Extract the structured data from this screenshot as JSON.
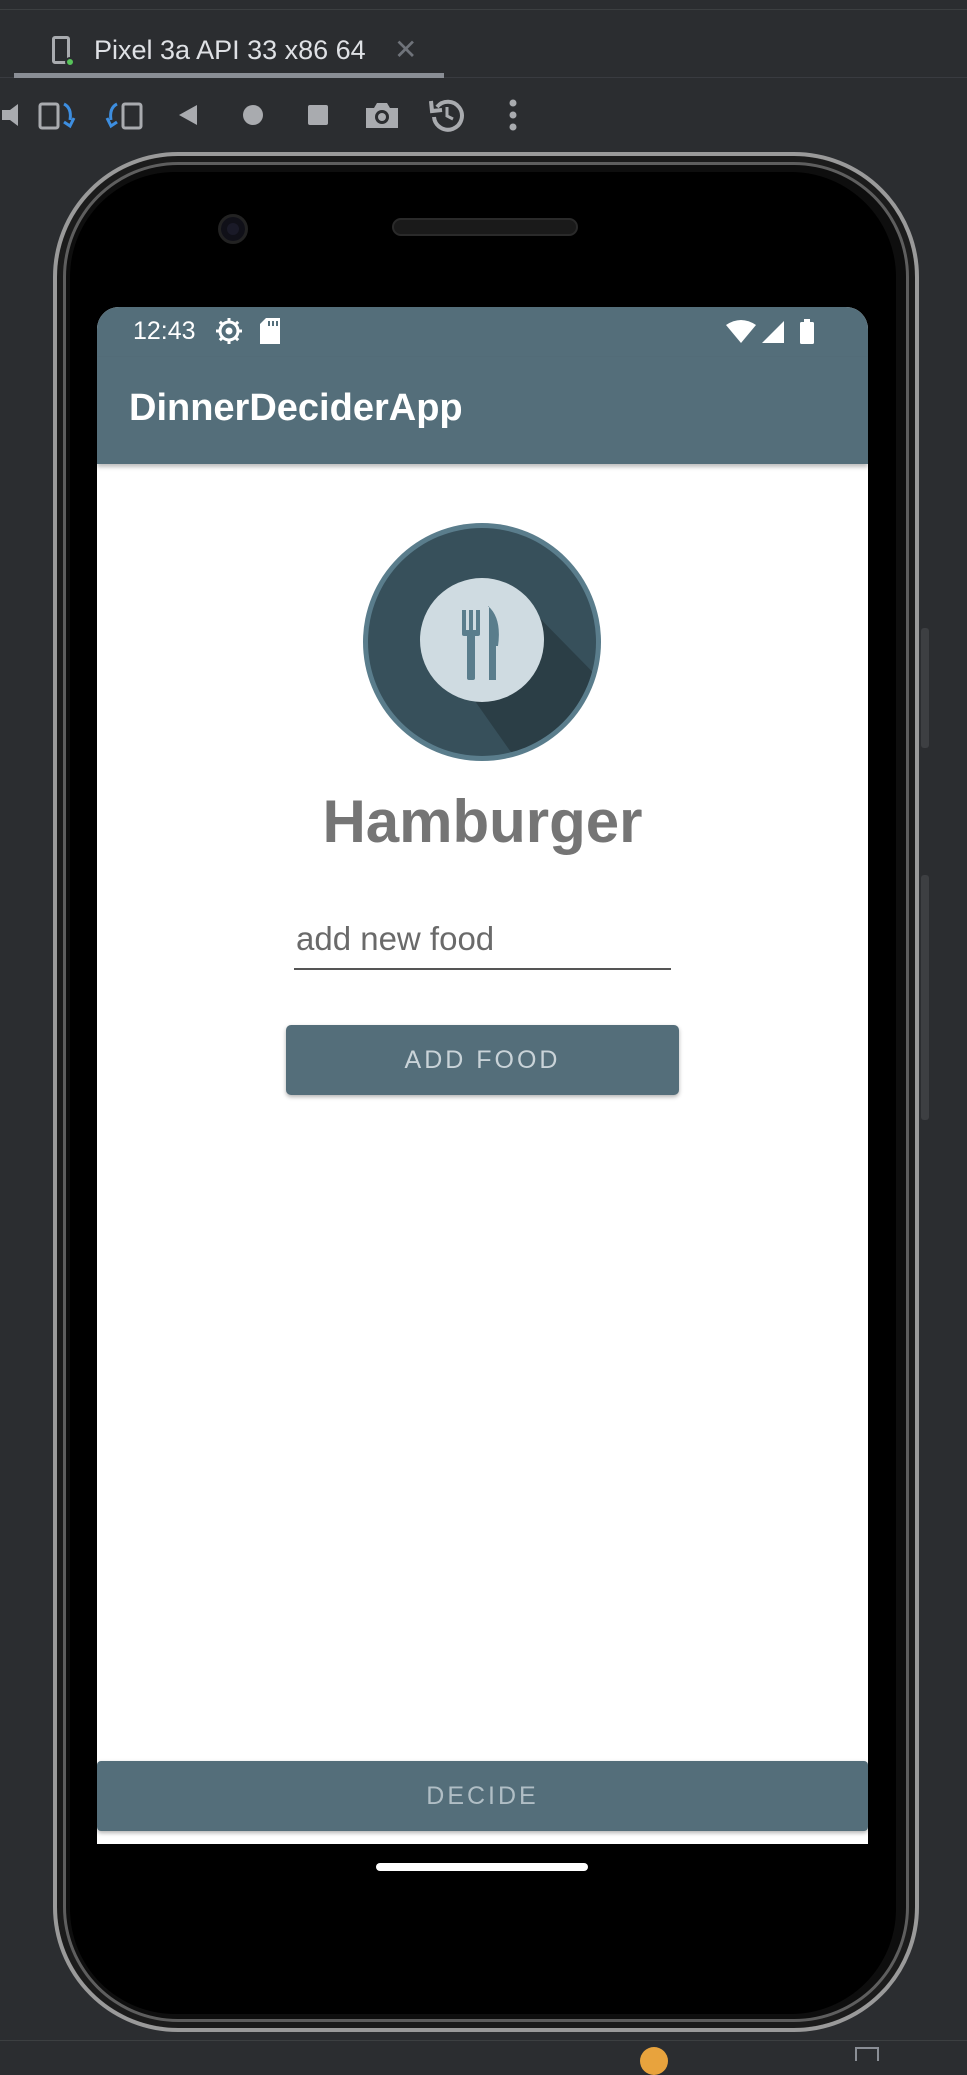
{
  "ide": {
    "device_tab": "Pixel 3a API 33 x86 64",
    "tab_close": "✕",
    "toolbar_icons": [
      "volume-icon",
      "rotate-left-icon",
      "rotate-right-icon",
      "back-icon",
      "home-icon",
      "overview-icon",
      "camera-icon",
      "reset-icon",
      "more-icon"
    ]
  },
  "status_bar": {
    "time": "12:43",
    "icons": [
      "settings-icon",
      "sd-card-icon",
      "wifi-icon",
      "signal-icon",
      "battery-icon"
    ]
  },
  "app": {
    "title": "DinnerDeciderApp",
    "food_name": "Hamburger",
    "input_placeholder": "add new food",
    "input_value": "",
    "add_button": "ADD FOOD",
    "decide_button": "DECIDE"
  },
  "colors": {
    "primary": "#546e7a",
    "ide_bg": "#2b2d30",
    "food_text": "#757575"
  }
}
